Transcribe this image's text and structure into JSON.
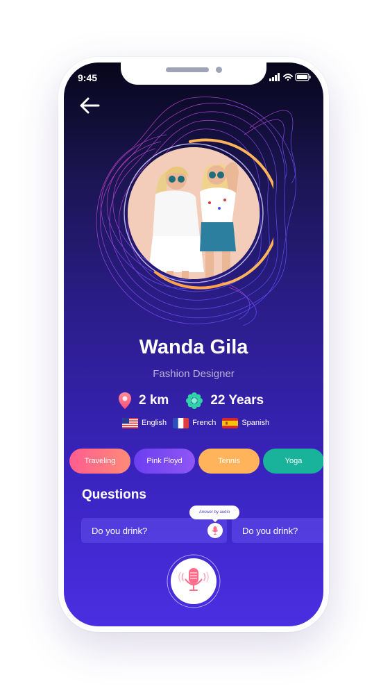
{
  "status_bar": {
    "time": "9:45"
  },
  "profile": {
    "name": "Wanda Gila",
    "occupation": "Fashion Designer",
    "distance": "2 km",
    "age": "22 Years"
  },
  "languages": [
    {
      "label": "English",
      "flag": "us-flag"
    },
    {
      "label": "French",
      "flag": "france-flag"
    },
    {
      "label": "Spanish",
      "flag": "spain-flag"
    }
  ],
  "interests": [
    "Traveling",
    "Pink Floyd",
    "Tennis",
    "Yoga"
  ],
  "questions": {
    "title": "Questions",
    "tooltip": "Answer by audio",
    "items": [
      "Do you drink?",
      "Do you drink?"
    ]
  },
  "colors": {
    "accent_orange": "#ffb45c",
    "accent_pink": "#ff5d8f",
    "accent_teal": "#18b39a",
    "accent_purple": "#6b3ff0",
    "mic_red": "#ff6b8a"
  }
}
